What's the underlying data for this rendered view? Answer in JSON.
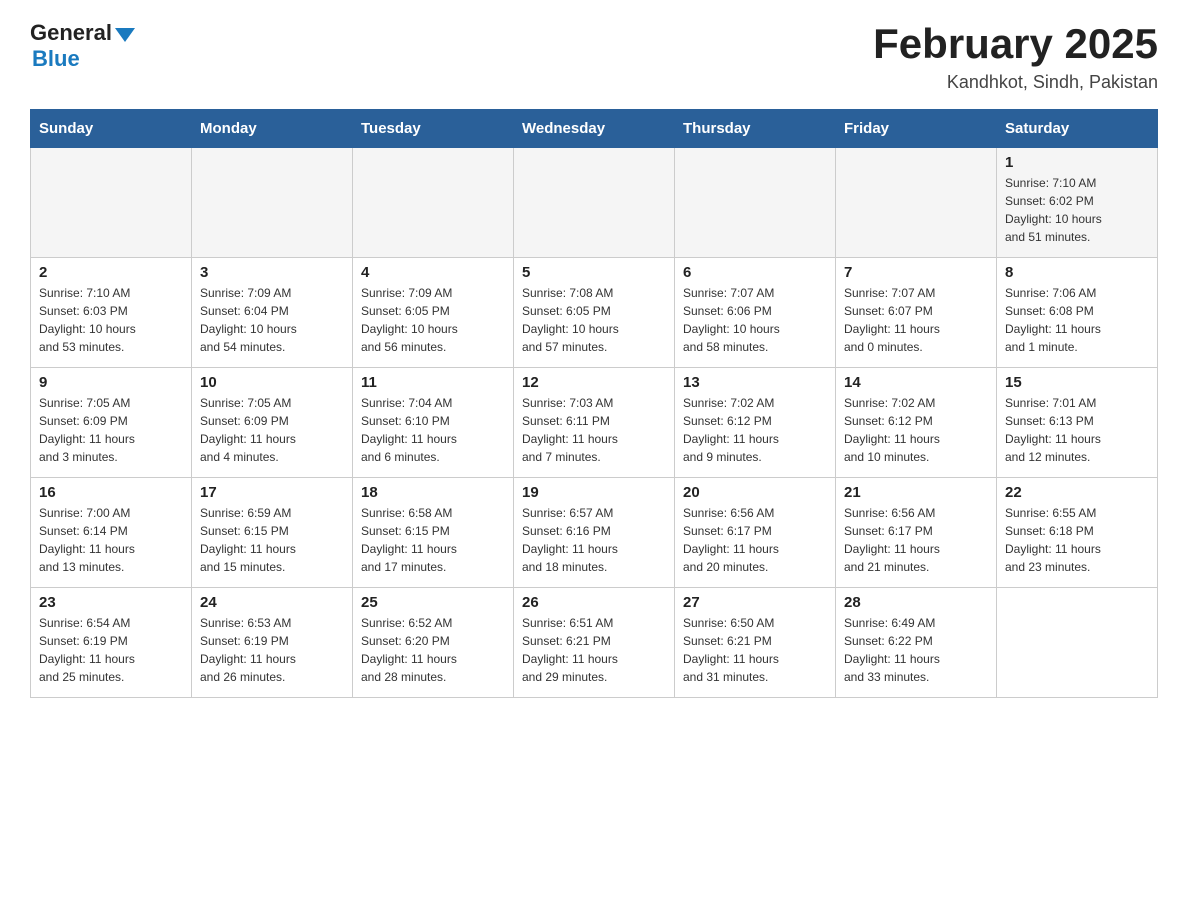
{
  "header": {
    "logo_general": "General",
    "logo_blue": "Blue",
    "month_title": "February 2025",
    "location": "Kandhkot, Sindh, Pakistan"
  },
  "days_of_week": [
    "Sunday",
    "Monday",
    "Tuesday",
    "Wednesday",
    "Thursday",
    "Friday",
    "Saturday"
  ],
  "weeks": [
    [
      {
        "num": "",
        "info": ""
      },
      {
        "num": "",
        "info": ""
      },
      {
        "num": "",
        "info": ""
      },
      {
        "num": "",
        "info": ""
      },
      {
        "num": "",
        "info": ""
      },
      {
        "num": "",
        "info": ""
      },
      {
        "num": "1",
        "info": "Sunrise: 7:10 AM\nSunset: 6:02 PM\nDaylight: 10 hours\nand 51 minutes."
      }
    ],
    [
      {
        "num": "2",
        "info": "Sunrise: 7:10 AM\nSunset: 6:03 PM\nDaylight: 10 hours\nand 53 minutes."
      },
      {
        "num": "3",
        "info": "Sunrise: 7:09 AM\nSunset: 6:04 PM\nDaylight: 10 hours\nand 54 minutes."
      },
      {
        "num": "4",
        "info": "Sunrise: 7:09 AM\nSunset: 6:05 PM\nDaylight: 10 hours\nand 56 minutes."
      },
      {
        "num": "5",
        "info": "Sunrise: 7:08 AM\nSunset: 6:05 PM\nDaylight: 10 hours\nand 57 minutes."
      },
      {
        "num": "6",
        "info": "Sunrise: 7:07 AM\nSunset: 6:06 PM\nDaylight: 10 hours\nand 58 minutes."
      },
      {
        "num": "7",
        "info": "Sunrise: 7:07 AM\nSunset: 6:07 PM\nDaylight: 11 hours\nand 0 minutes."
      },
      {
        "num": "8",
        "info": "Sunrise: 7:06 AM\nSunset: 6:08 PM\nDaylight: 11 hours\nand 1 minute."
      }
    ],
    [
      {
        "num": "9",
        "info": "Sunrise: 7:05 AM\nSunset: 6:09 PM\nDaylight: 11 hours\nand 3 minutes."
      },
      {
        "num": "10",
        "info": "Sunrise: 7:05 AM\nSunset: 6:09 PM\nDaylight: 11 hours\nand 4 minutes."
      },
      {
        "num": "11",
        "info": "Sunrise: 7:04 AM\nSunset: 6:10 PM\nDaylight: 11 hours\nand 6 minutes."
      },
      {
        "num": "12",
        "info": "Sunrise: 7:03 AM\nSunset: 6:11 PM\nDaylight: 11 hours\nand 7 minutes."
      },
      {
        "num": "13",
        "info": "Sunrise: 7:02 AM\nSunset: 6:12 PM\nDaylight: 11 hours\nand 9 minutes."
      },
      {
        "num": "14",
        "info": "Sunrise: 7:02 AM\nSunset: 6:12 PM\nDaylight: 11 hours\nand 10 minutes."
      },
      {
        "num": "15",
        "info": "Sunrise: 7:01 AM\nSunset: 6:13 PM\nDaylight: 11 hours\nand 12 minutes."
      }
    ],
    [
      {
        "num": "16",
        "info": "Sunrise: 7:00 AM\nSunset: 6:14 PM\nDaylight: 11 hours\nand 13 minutes."
      },
      {
        "num": "17",
        "info": "Sunrise: 6:59 AM\nSunset: 6:15 PM\nDaylight: 11 hours\nand 15 minutes."
      },
      {
        "num": "18",
        "info": "Sunrise: 6:58 AM\nSunset: 6:15 PM\nDaylight: 11 hours\nand 17 minutes."
      },
      {
        "num": "19",
        "info": "Sunrise: 6:57 AM\nSunset: 6:16 PM\nDaylight: 11 hours\nand 18 minutes."
      },
      {
        "num": "20",
        "info": "Sunrise: 6:56 AM\nSunset: 6:17 PM\nDaylight: 11 hours\nand 20 minutes."
      },
      {
        "num": "21",
        "info": "Sunrise: 6:56 AM\nSunset: 6:17 PM\nDaylight: 11 hours\nand 21 minutes."
      },
      {
        "num": "22",
        "info": "Sunrise: 6:55 AM\nSunset: 6:18 PM\nDaylight: 11 hours\nand 23 minutes."
      }
    ],
    [
      {
        "num": "23",
        "info": "Sunrise: 6:54 AM\nSunset: 6:19 PM\nDaylight: 11 hours\nand 25 minutes."
      },
      {
        "num": "24",
        "info": "Sunrise: 6:53 AM\nSunset: 6:19 PM\nDaylight: 11 hours\nand 26 minutes."
      },
      {
        "num": "25",
        "info": "Sunrise: 6:52 AM\nSunset: 6:20 PM\nDaylight: 11 hours\nand 28 minutes."
      },
      {
        "num": "26",
        "info": "Sunrise: 6:51 AM\nSunset: 6:21 PM\nDaylight: 11 hours\nand 29 minutes."
      },
      {
        "num": "27",
        "info": "Sunrise: 6:50 AM\nSunset: 6:21 PM\nDaylight: 11 hours\nand 31 minutes."
      },
      {
        "num": "28",
        "info": "Sunrise: 6:49 AM\nSunset: 6:22 PM\nDaylight: 11 hours\nand 33 minutes."
      },
      {
        "num": "",
        "info": ""
      }
    ]
  ]
}
